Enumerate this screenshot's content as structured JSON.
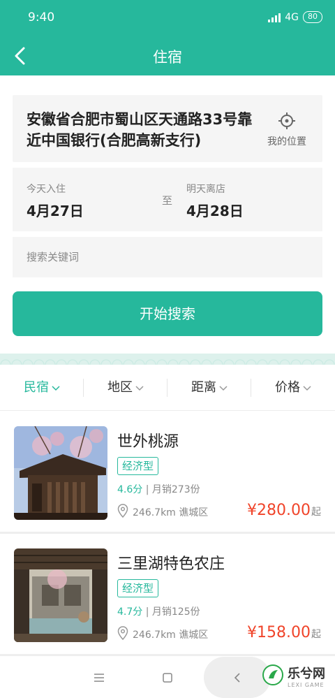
{
  "status_bar": {
    "time": "9:40",
    "network": "4G",
    "battery": "80"
  },
  "nav": {
    "title": "住宿"
  },
  "address": {
    "text": "安徽省合肥市蜀山区天通路33号靠近中国银行(合肥高新支行)",
    "my_location_label": "我的位置"
  },
  "dates": {
    "checkin_hint": "今天入住",
    "checkin_date": "4月27日",
    "separator": "至",
    "checkout_hint": "明天离店",
    "checkout_date": "4月28日"
  },
  "search": {
    "placeholder": "搜索关键词",
    "button_label": "开始搜索"
  },
  "filters": [
    {
      "label": "民宿",
      "active": true
    },
    {
      "label": "地区",
      "active": false
    },
    {
      "label": "距离",
      "active": false
    },
    {
      "label": "价格",
      "active": false
    }
  ],
  "listings": [
    {
      "name": "世外桃源",
      "tag": "经济型",
      "score": "4.6分",
      "sales": "| 月销273份",
      "distance": "246.7km 谯城区",
      "price": "¥280.00",
      "price_unit": "起"
    },
    {
      "name": "三里湖特色农庄",
      "tag": "经济型",
      "score": "4.7分",
      "sales": "| 月销125份",
      "distance": "246.7km 谯城区",
      "price": "¥158.00",
      "price_unit": "起"
    }
  ],
  "watermark": {
    "text": "乐兮网",
    "sub": "LEXI GAME"
  },
  "colors": {
    "accent": "#26b89c",
    "price": "#f0442a"
  }
}
